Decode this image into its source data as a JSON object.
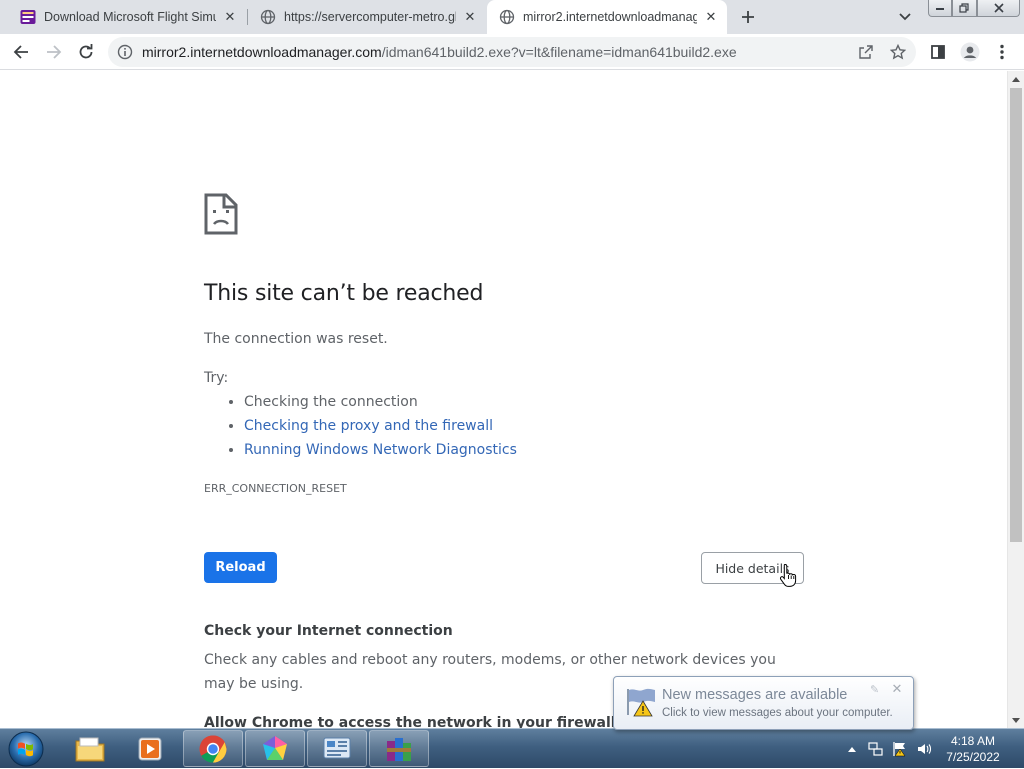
{
  "browser": {
    "tabs": [
      {
        "title": "Download Microsoft Flight Simul",
        "favicon": "flight-sim-favicon"
      },
      {
        "title": "https://servercomputer-metro.gl",
        "favicon": "globe-icon"
      },
      {
        "title": "mirror2.internetdownloadmanag",
        "favicon": "globe-icon",
        "active": true
      }
    ],
    "address": {
      "host": "mirror2.internetdownloadmanager.com",
      "path": "/idman641build2.exe?v=lt&filename=idman641build2.exe"
    }
  },
  "error_page": {
    "title": "This site can’t be reached",
    "description": "The connection was reset.",
    "try_label": "Try:",
    "suggestions": [
      {
        "text": "Checking the connection",
        "link": false
      },
      {
        "text": "Checking the proxy and the firewall",
        "link": true
      },
      {
        "text": "Running Windows Network Diagnostics",
        "link": true
      }
    ],
    "error_code": "ERR_CONNECTION_RESET",
    "reload_label": "Reload",
    "hide_details_label": "Hide details",
    "check_heading": "Check your Internet connection",
    "check_body": "Check any cables and reboot any routers, modems, or other network devices you may be using.",
    "allow_heading": "Allow Chrome to access the network in your firewall or antivirus settings."
  },
  "notification": {
    "title": "New messages are available",
    "message": "Click to view messages about your computer."
  },
  "taskbar": {
    "time": "4:18 AM",
    "date": "7/25/2022",
    "pinned": [
      "explorer-icon",
      "media-player-icon",
      "chrome-icon",
      "paint-icon",
      "control-panel-icon",
      "winrar-icon"
    ]
  },
  "colors": {
    "accent": "#1a73e8",
    "link": "#3367b6",
    "tabstrip": "#dee1e6"
  }
}
